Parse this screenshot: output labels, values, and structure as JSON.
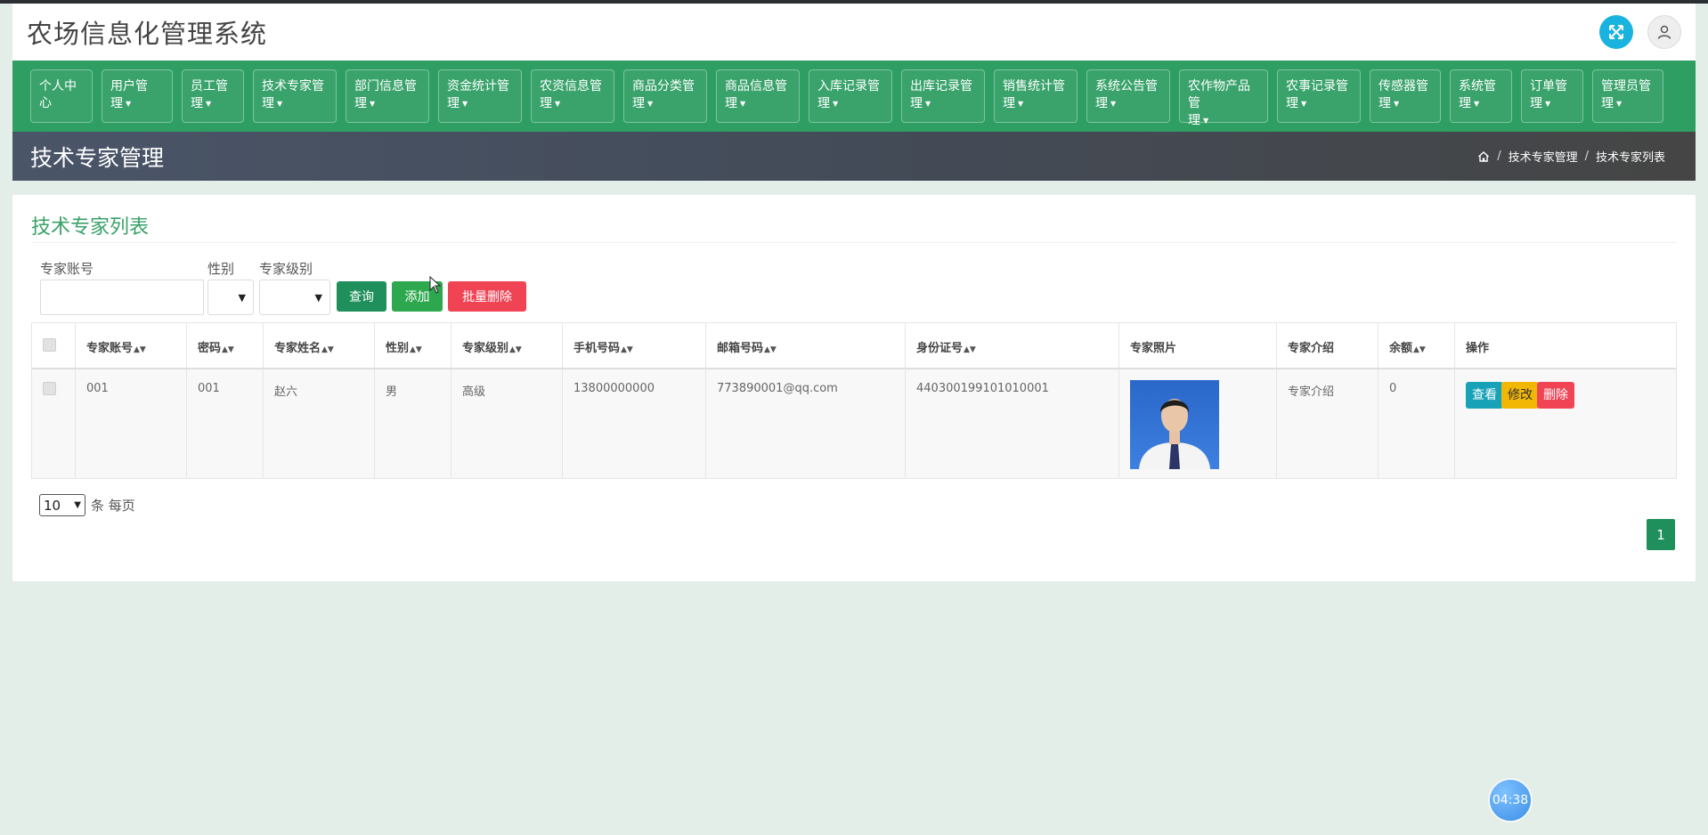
{
  "app": {
    "title": "农场信息化管理系统"
  },
  "nav": [
    {
      "line1": "个人中",
      "line2": "心",
      "caret": false
    },
    {
      "line1": "用户管",
      "line2": "理",
      "caret": true
    },
    {
      "line1": "员工管",
      "line2": "理",
      "caret": true
    },
    {
      "line1": "技术专家管",
      "line2": "理",
      "caret": true
    },
    {
      "line1": "部门信息管",
      "line2": "理",
      "caret": true
    },
    {
      "line1": "资金统计管",
      "line2": "理",
      "caret": true
    },
    {
      "line1": "农资信息管",
      "line2": "理",
      "caret": true
    },
    {
      "line1": "商品分类管",
      "line2": "理",
      "caret": true
    },
    {
      "line1": "商品信息管",
      "line2": "理",
      "caret": true
    },
    {
      "line1": "入库记录管",
      "line2": "理",
      "caret": true
    },
    {
      "line1": "出库记录管",
      "line2": "理",
      "caret": true
    },
    {
      "line1": "销售统计管",
      "line2": "理",
      "caret": true
    },
    {
      "line1": "系统公告管",
      "line2": "理",
      "caret": true
    },
    {
      "line1": "农作物产品管",
      "line2": "理",
      "caret": true
    },
    {
      "line1": "农事记录管",
      "line2": "理",
      "caret": true
    },
    {
      "line1": "传感器管",
      "line2": "理",
      "caret": true
    },
    {
      "line1": "系统管",
      "line2": "理",
      "caret": true
    },
    {
      "line1": "订单管",
      "line2": "理",
      "caret": true
    },
    {
      "line1": "管理员管",
      "line2": "理",
      "caret": true
    }
  ],
  "banner": {
    "title": "技术专家管理",
    "breadcrumb": [
      "技术专家管理",
      "技术专家列表"
    ],
    "separator": "/"
  },
  "card": {
    "title": "技术专家列表"
  },
  "filters": {
    "account_label": "专家账号",
    "account_value": "",
    "gender_label": "性别",
    "gender_value": "",
    "level_label": "专家级别",
    "level_value": ""
  },
  "buttons": {
    "query": "查询",
    "add": "添加",
    "batch_delete": "批量删除"
  },
  "table": {
    "headers": [
      "专家账号",
      "密码",
      "专家姓名",
      "性别",
      "专家级别",
      "手机号码",
      "邮箱号码",
      "身份证号",
      "专家照片",
      "专家介绍",
      "余额",
      "操作"
    ],
    "rows": [
      {
        "account": "001",
        "password": "001",
        "name": "赵六",
        "gender": "男",
        "level": "高级",
        "phone": "13800000000",
        "email": "773890001@qq.com",
        "id_number": "440300199101010001",
        "intro": "专家介绍",
        "balance": "0",
        "actions": {
          "view": "查看",
          "edit": "修改",
          "delete": "删除"
        }
      }
    ]
  },
  "pager": {
    "page_size": "10",
    "per_page_text": "条 每页",
    "current_page": "1"
  },
  "timer": {
    "text": "04:38"
  },
  "colors": {
    "nav_green": "#2e9e63",
    "accent_green": "#1f8f5c",
    "danger": "#f04455",
    "info": "#17a2b8",
    "warning": "#f2b705"
  }
}
